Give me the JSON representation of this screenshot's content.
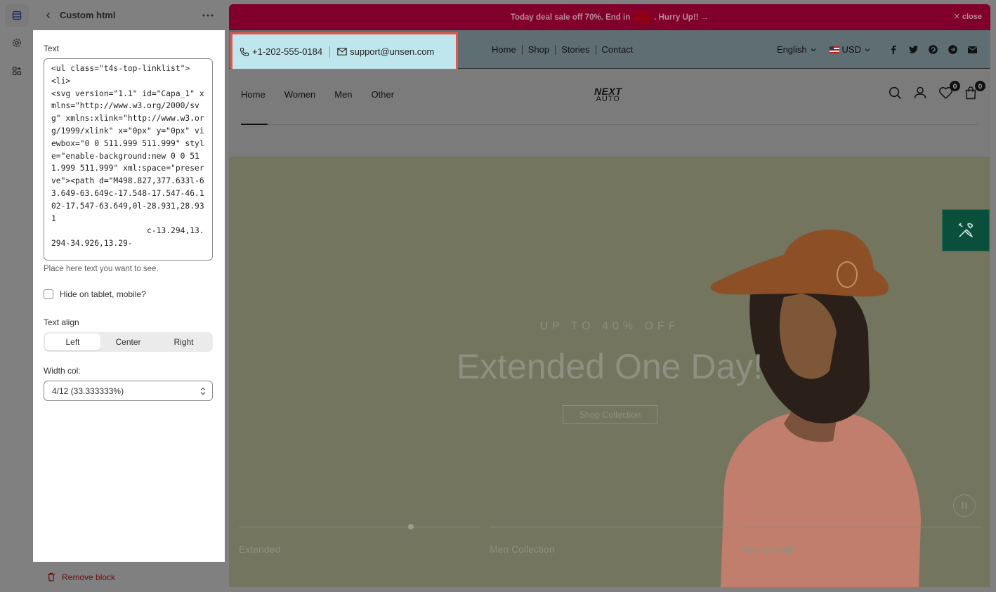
{
  "sidebar": {
    "title": "Custom html",
    "text_label": "Text",
    "code_text": "<ul class=\"t4s-top-linklist\">\n<li>\n<svg version=\"1.1\" id=\"Capa_1\" xmlns=\"http://www.w3.org/2000/svg\" xmlns:xlink=\"http://www.w3.org/1999/xlink\" x=\"0px\" y=\"0px\" viewbox=\"0 0 511.999 511.999\" style=\"enable-background:new 0 0 511.999 511.999\" xml:space=\"preserve\"><path d=\"M498.827,377.633l-63.649-63.649c-17.548-17.547-46.102-17.547-63.649,0l-28.931,28.931\n                    c-13.294,13.294-34.926,13.29-",
    "help_text": "Place here text you want to see.",
    "hide_label": "Hide on tablet, mobile?",
    "align_label": "Text align",
    "align_options": [
      "Left",
      "Center",
      "Right"
    ],
    "width_label": "Width col:",
    "width_value": "4/12 (33.333333%)",
    "remove_label": "Remove block"
  },
  "preview": {
    "announcement": {
      "text_before": "Today deal sale off 70%. End in",
      "text_after": ". Hurry Up!! →",
      "close_label": "close"
    },
    "contact": {
      "phone": "+1-202-555-0184",
      "email": "support@unsen.com"
    },
    "top_links": [
      "Home",
      "Shop",
      "Stories",
      "Contact"
    ],
    "language": "English",
    "currency": "USD",
    "main_nav": [
      "Home",
      "Women",
      "Men",
      "Other"
    ],
    "logo": {
      "line1": "NEXT",
      "line2": "AUTO"
    },
    "wishlist_count": "0",
    "cart_count": "0",
    "hero": {
      "subtitle": "UP TO 40% OFF",
      "title": "Extended One Day!",
      "button": "Shop Collection"
    },
    "slides": [
      "Extended",
      "Men Collection",
      "New arrivals"
    ]
  },
  "colors": {
    "announcement_bg": "#81002b",
    "highlight_border": "#e8534a",
    "contact_bg": "#bfe6ec",
    "tool_bg": "#0a4f3c"
  }
}
